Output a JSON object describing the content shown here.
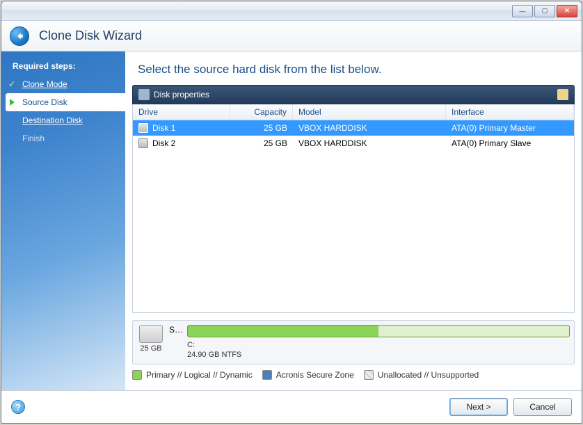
{
  "window": {
    "title": "Clone Disk Wizard"
  },
  "sidebar": {
    "header": "Required steps:",
    "items": [
      {
        "label": "Clone Mode",
        "state": "done"
      },
      {
        "label": "Source Disk",
        "state": "active"
      },
      {
        "label": "Destination Disk",
        "state": "pending"
      },
      {
        "label": "Finish",
        "state": "disabled"
      }
    ]
  },
  "instruction": "Select the source hard disk from the list below.",
  "panel": {
    "title": "Disk properties"
  },
  "table": {
    "columns": {
      "drive": "Drive",
      "capacity": "Capacity",
      "model": "Model",
      "interface": "Interface"
    },
    "rows": [
      {
        "drive": "Disk 1",
        "capacity": "25 GB",
        "model": "VBOX HARDDISK",
        "interface": "ATA(0) Primary Master",
        "selected": true
      },
      {
        "drive": "Disk 2",
        "capacity": "25 GB",
        "model": "VBOX HARDDISK",
        "interface": "ATA(0) Primary Slave",
        "selected": false
      }
    ]
  },
  "volume": {
    "disk_total": "25 GB",
    "short_label": "S…",
    "partition_letter": "C:",
    "partition_size_fs": "24.90 GB  NTFS"
  },
  "legend": {
    "primary": "Primary // Logical // Dynamic",
    "asz": "Acronis Secure Zone",
    "unalloc": "Unallocated // Unsupported"
  },
  "buttons": {
    "next": "Next >",
    "cancel": "Cancel"
  }
}
